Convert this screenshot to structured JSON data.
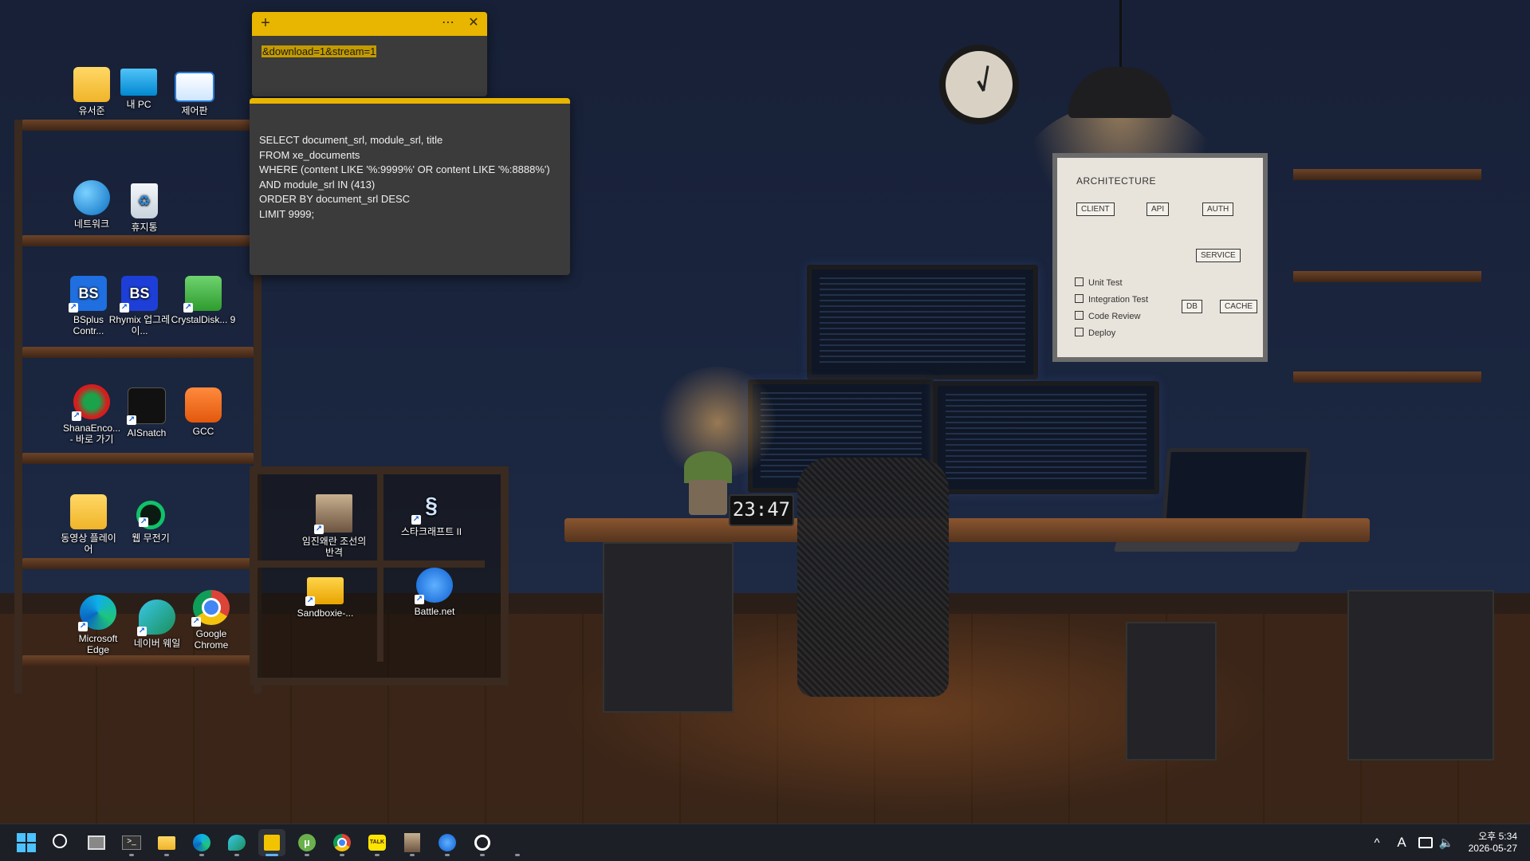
{
  "desktop_icons": [
    {
      "label": "유서준",
      "icon": "folder-icon"
    },
    {
      "label": "내 PC",
      "icon": "monitor-icon"
    },
    {
      "label": "제어판",
      "icon": "control-panel-icon"
    },
    {
      "label": "네트워크",
      "icon": "network-icon"
    },
    {
      "label": "휴지통",
      "icon": "recycle-bin-icon"
    },
    {
      "label": "BSplus Contr...",
      "icon": "bsplus-icon",
      "glyph": "BS"
    },
    {
      "label": "Rhymix 업그레이...",
      "icon": "rhymix-icon",
      "glyph": "BS"
    },
    {
      "label": "CrystalDisk... 9",
      "icon": "crystaldisk-icon"
    },
    {
      "label": "ShanaEnco... - 바로 가기",
      "icon": "shanaencoder-icon"
    },
    {
      "label": "AISnatch",
      "icon": "aisnatch-icon"
    },
    {
      "label": "GCC",
      "icon": "gcc-icon"
    },
    {
      "label": "동영상 플레이어",
      "icon": "folder-icon"
    },
    {
      "label": "웹 무전기",
      "icon": "web-radio-icon"
    },
    {
      "label": "Microsoft Edge",
      "icon": "edge-icon"
    },
    {
      "label": "네이버 웨일",
      "icon": "whale-icon"
    },
    {
      "label": "Google Chrome",
      "icon": "chrome-icon"
    },
    {
      "label": "임진왜란 조선의 반격",
      "icon": "game-portrait-icon"
    },
    {
      "label": "스타크래프트 II",
      "icon": "starcraft-icon"
    },
    {
      "label": "Sandboxie-...",
      "icon": "sandboxie-icon"
    },
    {
      "label": "Battle.net",
      "icon": "battlenet-icon"
    }
  ],
  "note_small": {
    "add_glyph": "+",
    "menu_glyph": "⋯",
    "close_glyph": "✕",
    "text": "&download=1&stream=1"
  },
  "note_large": {
    "text": "SELECT document_srl, module_srl, title\nFROM xe_documents\nWHERE (content LIKE '%:9999%' OR content LIKE '%:8888%')\nAND module_srl IN (413)\nORDER BY document_srl DESC\nLIMIT 9999;"
  },
  "wallpaper": {
    "whiteboard_title": "ARCHITECTURE",
    "boxes": [
      "CLIENT",
      "API",
      "AUTH",
      "SERVICE",
      "DB",
      "CACHE"
    ],
    "checklist": [
      "Unit Test",
      "Integration Test",
      "Code Review",
      "Deploy"
    ],
    "desk_clock": "23:47"
  },
  "taskbar": {
    "apps": [
      {
        "name": "start-icon",
        "active": false,
        "running": false
      },
      {
        "name": "search-icon",
        "active": false,
        "running": false
      },
      {
        "name": "task-view-icon",
        "active": false,
        "running": false
      },
      {
        "name": "terminal-icon",
        "active": false,
        "running": true
      },
      {
        "name": "file-explorer-icon",
        "active": false,
        "running": true
      },
      {
        "name": "edge-icon",
        "active": false,
        "running": true
      },
      {
        "name": "whale-icon",
        "active": false,
        "running": true
      },
      {
        "name": "sticky-notes-icon",
        "active": true,
        "running": true
      },
      {
        "name": "utorrent-icon",
        "active": false,
        "running": true
      },
      {
        "name": "chrome-icon",
        "active": false,
        "running": true
      },
      {
        "name": "kakaotalk-icon",
        "active": false,
        "running": true
      },
      {
        "name": "game-portrait-icon",
        "active": false,
        "running": true
      },
      {
        "name": "battlenet-icon",
        "active": false,
        "running": true
      },
      {
        "name": "chatgpt-icon",
        "active": false,
        "running": true
      },
      {
        "name": "more-icon",
        "active": false,
        "running": true
      }
    ],
    "kakao_label": "TALK",
    "tray": {
      "chevron": "^",
      "ime": "A",
      "time": "오후 5:34",
      "date": "2026-05-27"
    }
  },
  "colors": {
    "note_accent": "#e8b500",
    "note_bg": "#3b3b3b",
    "taskbar_bg": "#1c1f26",
    "active_indicator": "#5cb3ff"
  }
}
